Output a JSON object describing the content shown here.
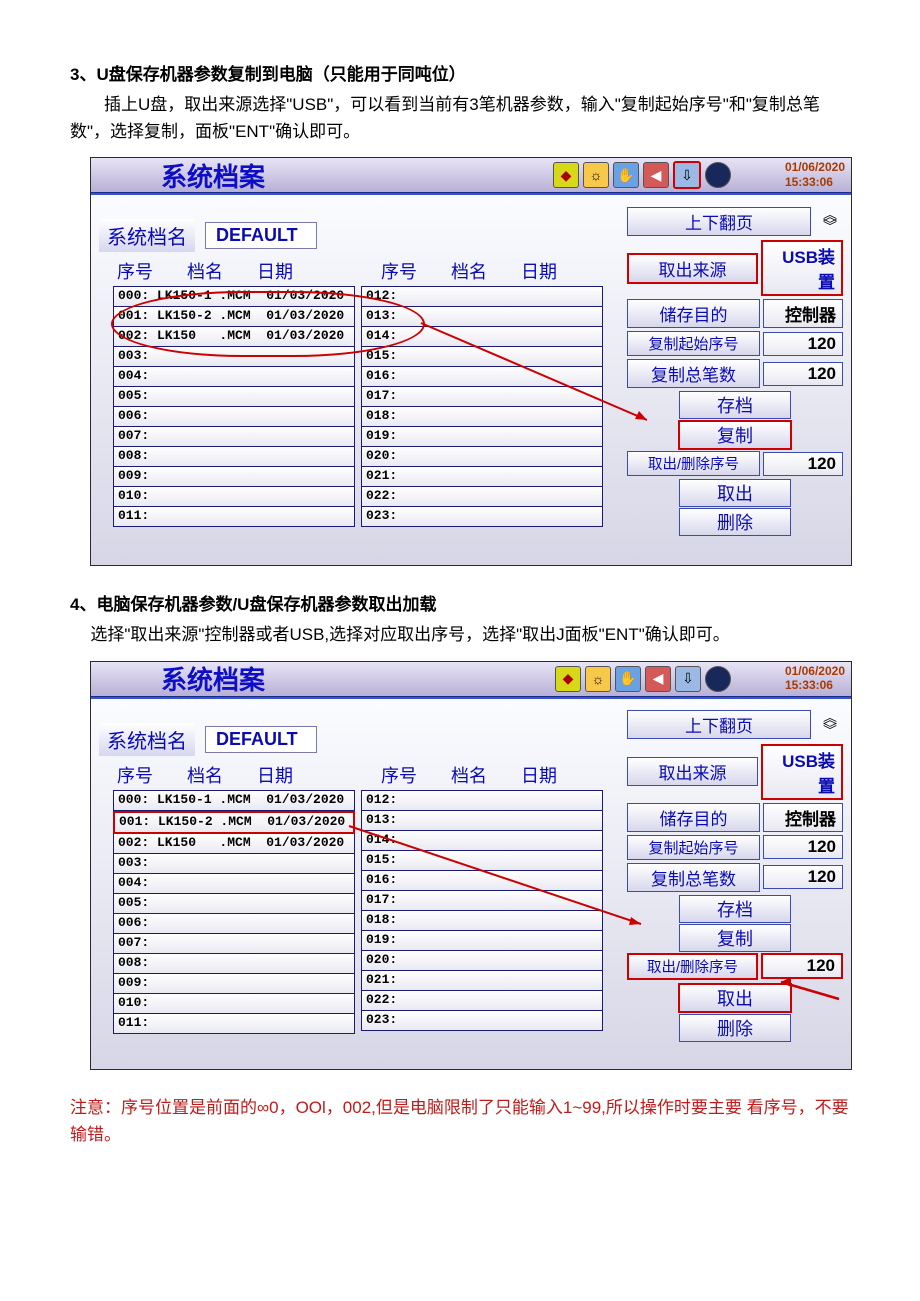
{
  "section3": {
    "heading": "3、U盘保存机器参数复制到电脑（只能用于同吨位）",
    "para": "插上U盘，取出来源选择\"USB\"，可以看到当前有3笔机器参数，输入\"复制起始序号\"和\"复制总笔数\"，选择复制，面板\"ENT\"确认即可。"
  },
  "section4": {
    "heading": "4、电脑保存机器参数/U盘保存机器参数取出加载",
    "para": "选择\"取出来源\"控制器或者USB,选择对应取出序号，选择\"取出J面板\"ENT\"确认即可。"
  },
  "note": "注意：序号位置是前面的∞0，OOl，002,但是电脑限制了只能输入1~99,所以操作时要主要 看序号，不要输错。",
  "hmi": {
    "title": "系统档案",
    "date": "01/06/2020",
    "time": "15:33:06",
    "file_name_label": "系统档名",
    "file_name_value": "DEFAULT",
    "col_hdr_idx": "序号",
    "col_hdr_name": "档名",
    "col_hdr_date": "日期",
    "colA": [
      "000: LK150-1 .MCM  01/03/2020",
      "001: LK150-2 .MCM  01/03/2020",
      "002: LK150   .MCM  01/03/2020",
      "003:",
      "004:",
      "005:",
      "006:",
      "007:",
      "008:",
      "009:",
      "010:",
      "011:"
    ],
    "colB": [
      "012:",
      "013:",
      "014:",
      "015:",
      "016:",
      "017:",
      "018:",
      "019:",
      "020:",
      "021:",
      "022:",
      "023:"
    ],
    "right": {
      "page": "上下翻页",
      "src_label": "取出来源",
      "src_value": "USB装置",
      "dst_label": "储存目的",
      "dst_value": "控制器",
      "copy_start_label": "复制起始序号",
      "copy_start_value": "120",
      "copy_count_label": "复制总笔数",
      "copy_count_value": "120",
      "save": "存档",
      "copy": "复制",
      "idx_label": "取出/删除序号",
      "idx_value": "120",
      "load": "取出",
      "delete": "删除"
    }
  }
}
